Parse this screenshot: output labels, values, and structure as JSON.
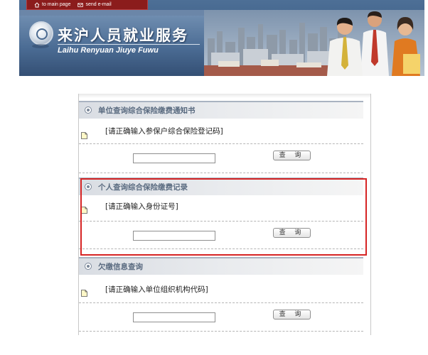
{
  "header": {
    "nav": [
      {
        "label": "to main page",
        "icon": "home-icon"
      },
      {
        "label": "send e-mail",
        "icon": "mail-icon"
      }
    ],
    "title": "来沪人员就业服务",
    "subtitle": "Laihu Renyuan Jiuye Fuwu"
  },
  "sections": [
    {
      "title": "单位查询综合保险缴费通知书",
      "hint": "[请正确输入参保户综合保险登记码]",
      "input_value": "",
      "button_label": "查 询"
    },
    {
      "title": "个人查询综合保险缴费记录",
      "hint": "[请正确输入身份证号]",
      "input_value": "",
      "button_label": "查 询"
    },
    {
      "title": "欠缴信息查询",
      "hint": "[请正确输入单位组织机构代码]",
      "input_value": "",
      "button_label": "查 询"
    }
  ],
  "colors": {
    "banner": "#3e5f86",
    "nav_bar": "#8b1c1c",
    "section_title": "#5a6b80",
    "highlight": "#d62424"
  }
}
